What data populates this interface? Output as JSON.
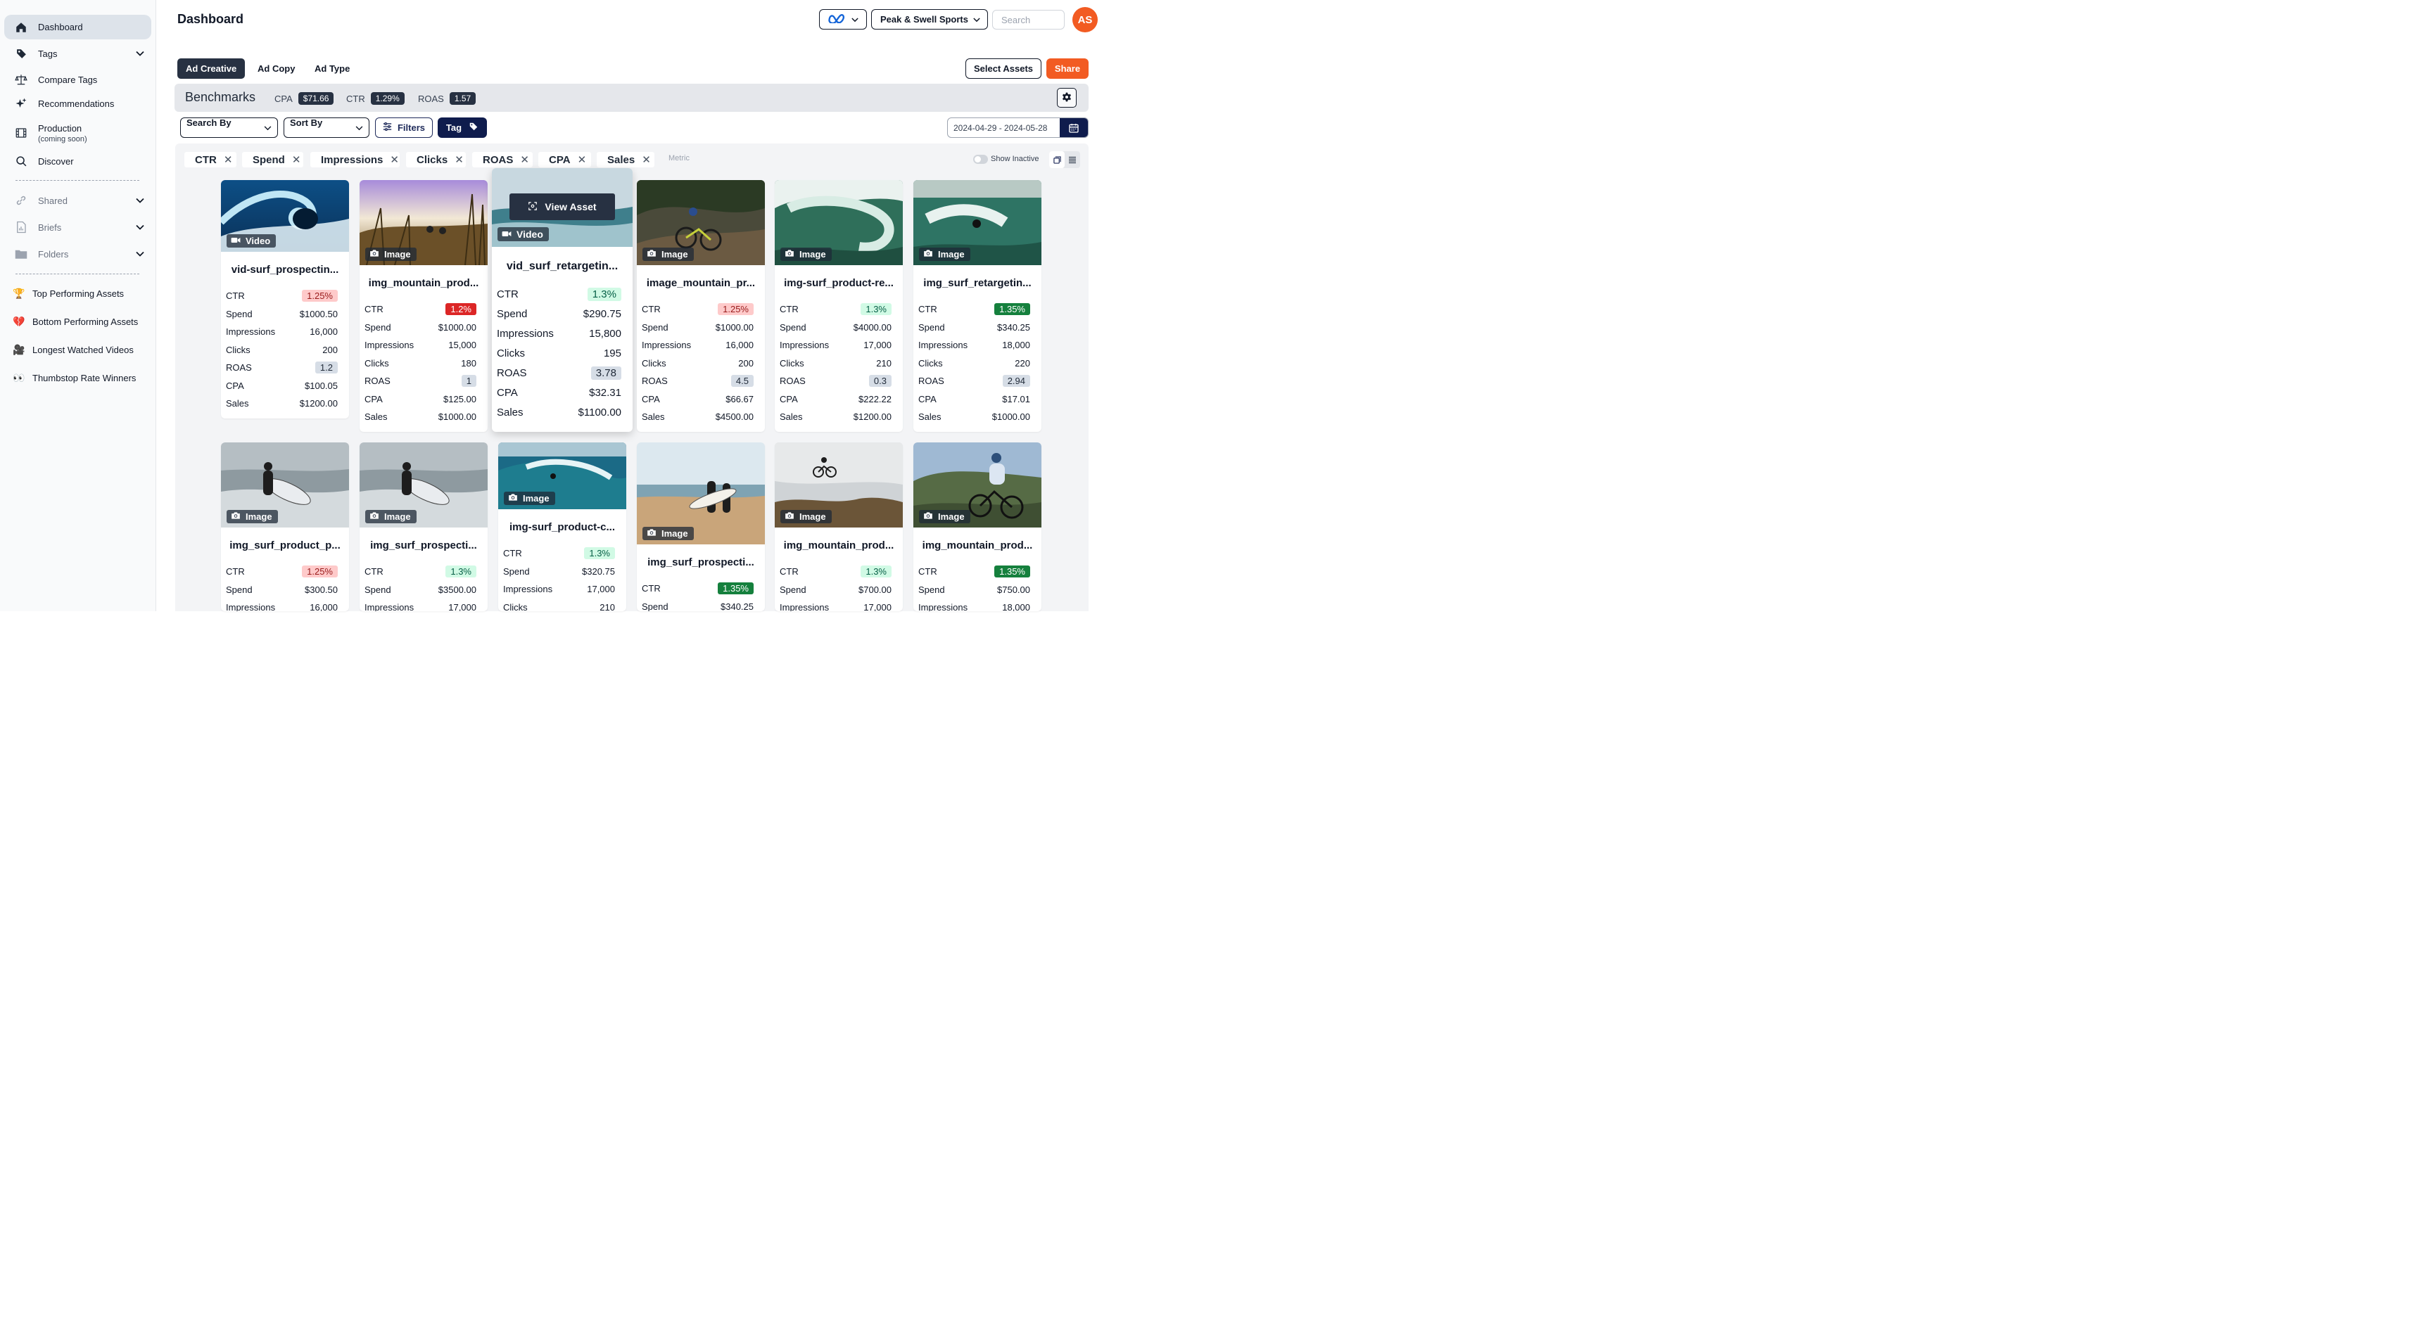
{
  "sidebar": {
    "items": [
      {
        "label": "Dashboard",
        "icon": "home-icon",
        "active": true
      },
      {
        "label": "Tags",
        "icon": "tag-icon",
        "expandable": true
      },
      {
        "label": "Compare Tags",
        "icon": "scale-icon"
      },
      {
        "label": "Recommendations",
        "icon": "sparkle-icon"
      },
      {
        "label": "Production",
        "sub": "(coming soon)",
        "icon": "film-icon"
      },
      {
        "label": "Discover",
        "icon": "search-icon"
      },
      {
        "label": "Shared",
        "icon": "link-icon",
        "expandable": true
      },
      {
        "label": "Briefs",
        "icon": "document-icon",
        "expandable": true
      },
      {
        "label": "Folders",
        "icon": "folder-icon",
        "expandable": true
      }
    ],
    "quick_links": [
      {
        "emoji": "🏆",
        "label": "Top Performing Assets"
      },
      {
        "emoji": "💔",
        "label": "Bottom Performing Assets"
      },
      {
        "emoji": "🎥",
        "label": "Longest Watched Videos"
      },
      {
        "emoji": "👀",
        "label": "Thumbstop Rate Winners"
      }
    ]
  },
  "header": {
    "title": "Dashboard",
    "account": "Peak & Swell Sports",
    "search_placeholder": "Search",
    "avatar_initials": "AS",
    "brand_color": "#f25b22"
  },
  "tabs": [
    "Ad Creative",
    "Ad Copy",
    "Ad Type"
  ],
  "actions": {
    "select_assets": "Select Assets",
    "share": "Share"
  },
  "benchmarks": {
    "title": "Benchmarks",
    "metrics": [
      {
        "label": "CPA",
        "value": "$71.66"
      },
      {
        "label": "CTR",
        "value": "1.29%"
      },
      {
        "label": "ROAS",
        "value": "1.57"
      }
    ]
  },
  "filters": {
    "search_by": "Search By ______",
    "sort_by": "Sort By ______",
    "filters_label": "Filters",
    "tag_label": "Tag",
    "date_range": "2024-04-29 - 2024-05-28"
  },
  "metric_chips": [
    "CTR",
    "Spend",
    "Impressions",
    "Clicks",
    "ROAS",
    "CPA",
    "Sales"
  ],
  "metric_placeholder": "Metric",
  "show_inactive": "Show Inactive",
  "view_asset_label": "View Asset",
  "metric_labels": [
    "CTR",
    "Spend",
    "Impressions",
    "Clicks",
    "ROAS",
    "CPA",
    "Sales"
  ],
  "cards": [
    {
      "name": "vid-surf_prospectin...",
      "type": "Video",
      "scene": "wave",
      "ctr": "1.25%",
      "ctr_style": "red-light",
      "spend": "$1000.50",
      "impressions": "16,000",
      "clicks": "200",
      "roas": "1.2",
      "cpa": "$100.05",
      "sales": "$1200.00"
    },
    {
      "name": "img_mountain_prod...",
      "type": "Image",
      "scene": "bikers-grass",
      "ctr": "1.2%",
      "ctr_style": "red",
      "spend": "$1000.00",
      "impressions": "15,000",
      "clicks": "180",
      "roas": "1",
      "cpa": "$125.00",
      "sales": "$1000.00"
    },
    {
      "name": "vid_surf_retargetin...",
      "type": "Video",
      "scene": "surf-hover",
      "ctr": "1.3%",
      "ctr_style": "green-light",
      "spend": "$290.75",
      "impressions": "15,800",
      "clicks": "195",
      "roas": "3.78",
      "cpa": "$32.31",
      "sales": "$1100.00"
    },
    {
      "name": "image_mountain_pr...",
      "type": "Image",
      "scene": "biker-forest",
      "ctr": "1.25%",
      "ctr_style": "red-light",
      "spend": "$1000.00",
      "impressions": "16,000",
      "clicks": "200",
      "roas": "4.5",
      "cpa": "$66.67",
      "sales": "$4500.00"
    },
    {
      "name": "img-surf_product-re...",
      "type": "Image",
      "scene": "barrel",
      "ctr": "1.3%",
      "ctr_style": "green-light",
      "spend": "$4000.00",
      "impressions": "17,000",
      "clicks": "210",
      "roas": "0.3",
      "cpa": "$222.22",
      "sales": "$1200.00"
    },
    {
      "name": "img_surf_retargetin...",
      "type": "Image",
      "scene": "surfer-wave",
      "ctr": "1.35%",
      "ctr_style": "green",
      "spend": "$340.25",
      "impressions": "18,000",
      "clicks": "220",
      "roas": "2.94",
      "cpa": "$17.01",
      "sales": "$1000.00"
    },
    {
      "name": "img_surf_product_p...",
      "type": "Image",
      "scene": "surfboard-water",
      "ctr": "1.25%",
      "ctr_style": "red-light",
      "spend": "$300.50",
      "impressions": "16,000"
    },
    {
      "name": "img_surf_prospecti...",
      "type": "Image",
      "scene": "surfboard-water",
      "ctr": "1.3%",
      "ctr_style": "green-light",
      "spend": "$3500.00",
      "impressions": "17,000"
    },
    {
      "name": "img-surf_product-c...",
      "type": "Image",
      "scene": "surf-ocean",
      "ctr": "1.3%",
      "ctr_style": "green-light",
      "spend": "$320.75",
      "impressions": "17,000",
      "clicks": "210"
    },
    {
      "name": "img_surf_prospecti...",
      "type": "Image",
      "scene": "beach-walk",
      "ctr": "1.35%",
      "ctr_style": "green",
      "spend": "$340.25"
    },
    {
      "name": "img_mountain_prod...",
      "type": "Image",
      "scene": "bike-jump",
      "ctr": "1.3%",
      "ctr_style": "green-light",
      "spend": "$700.00",
      "impressions": "17,000"
    },
    {
      "name": "img_mountain_prod...",
      "type": "Image",
      "scene": "biker-hill",
      "ctr": "1.35%",
      "ctr_style": "green",
      "spend": "$750.00",
      "impressions": "18,000"
    }
  ]
}
